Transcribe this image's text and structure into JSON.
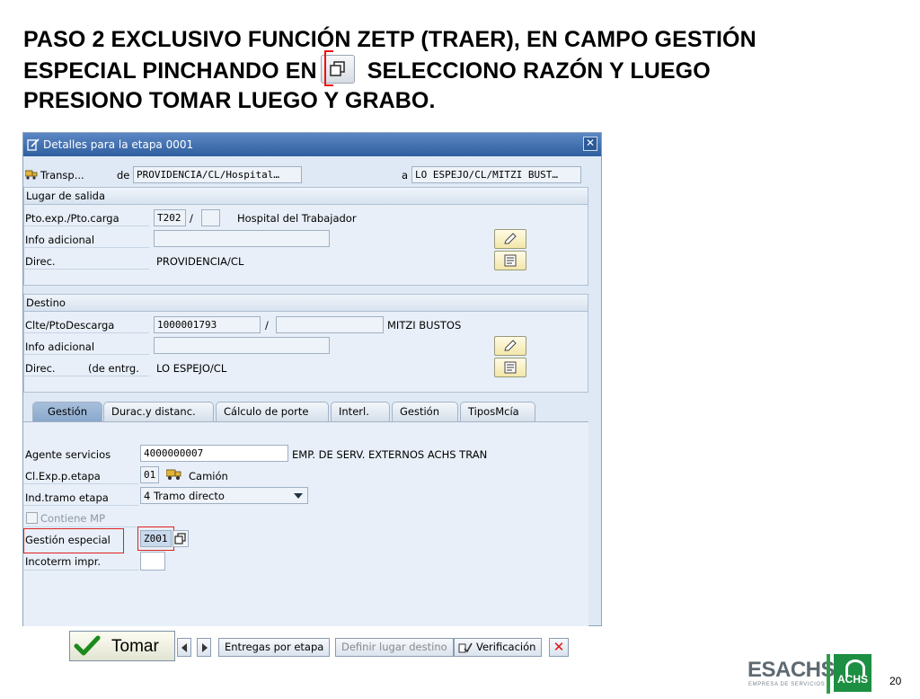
{
  "slide": {
    "title_line1": "PASO 2 EXCLUSIVO FUNCIÓN ZETP (TRAER), EN CAMPO GESTIÓN",
    "title_line2a": "ESPECIAL PINCHANDO EN",
    "title_line2b": "SELECCIONO RAZÓN Y LUEGO",
    "title_line3": "PRESIONO  TOMAR LUEGO Y  GRABO.",
    "page_number": "20"
  },
  "dialog": {
    "title": "Detalles para la etapa 0001",
    "close_label": "✕",
    "transport": {
      "label": "Transp...",
      "de_label": "de",
      "de_value": "PROVIDENCIA/CL/Hospital…",
      "a_label": "a",
      "a_value": "LO ESPEJO/CL/MITZI BUST…"
    },
    "lugar_salida": {
      "header": "Lugar de salida",
      "pto_label": "Pto.exp./Pto.carga",
      "pto_value": "T202",
      "slash": "/",
      "pto_name": "Hospital del Trabajador",
      "info_label": "Info adicional",
      "direc_label": "Direc.",
      "direc_value": "PROVIDENCIA/CL"
    },
    "destino": {
      "header": "Destino",
      "clte_label": "Clte/PtoDescarga",
      "clte_value": "1000001793",
      "slash": "/",
      "clte_name": "MITZI BUSTOS",
      "info_label": "Info adicional",
      "direc_label": "Direc.",
      "direc_sub": "(de entrg.",
      "direc_value": "LO ESPEJO/CL"
    },
    "tabs": [
      "Gestión",
      "Durac.y distanc.",
      "Cálculo de porte",
      "Interl.",
      "Gestión",
      "TiposMcía"
    ],
    "gestion": {
      "agente_label": "Agente servicios",
      "agente_value": "4000000007",
      "agente_name": "EMP. DE SERV. EXTERNOS ACHS TRAN",
      "clexp_label": "Cl.Exp.p.etapa",
      "clexp_value": "01",
      "clexp_name": "Camión",
      "ind_label": "Ind.tramo etapa",
      "ind_value": "4 Tramo directo",
      "contiene_label": "Contiene MP",
      "gestion_label": "Gestión especial",
      "gestion_value": "Z001",
      "incoterm_label": "Incoterm impr."
    }
  },
  "toolbar": {
    "tomar_label": "Tomar",
    "entregas_label": "Entregas por etapa",
    "definir_label": "Definir lugar destino",
    "verificacion_label": "Verificación"
  },
  "footer": {
    "logo_main": "ESACHS",
    "logo_sub": "EMPRESA DE SERVICIOS",
    "logo_achs": "ACHS"
  }
}
